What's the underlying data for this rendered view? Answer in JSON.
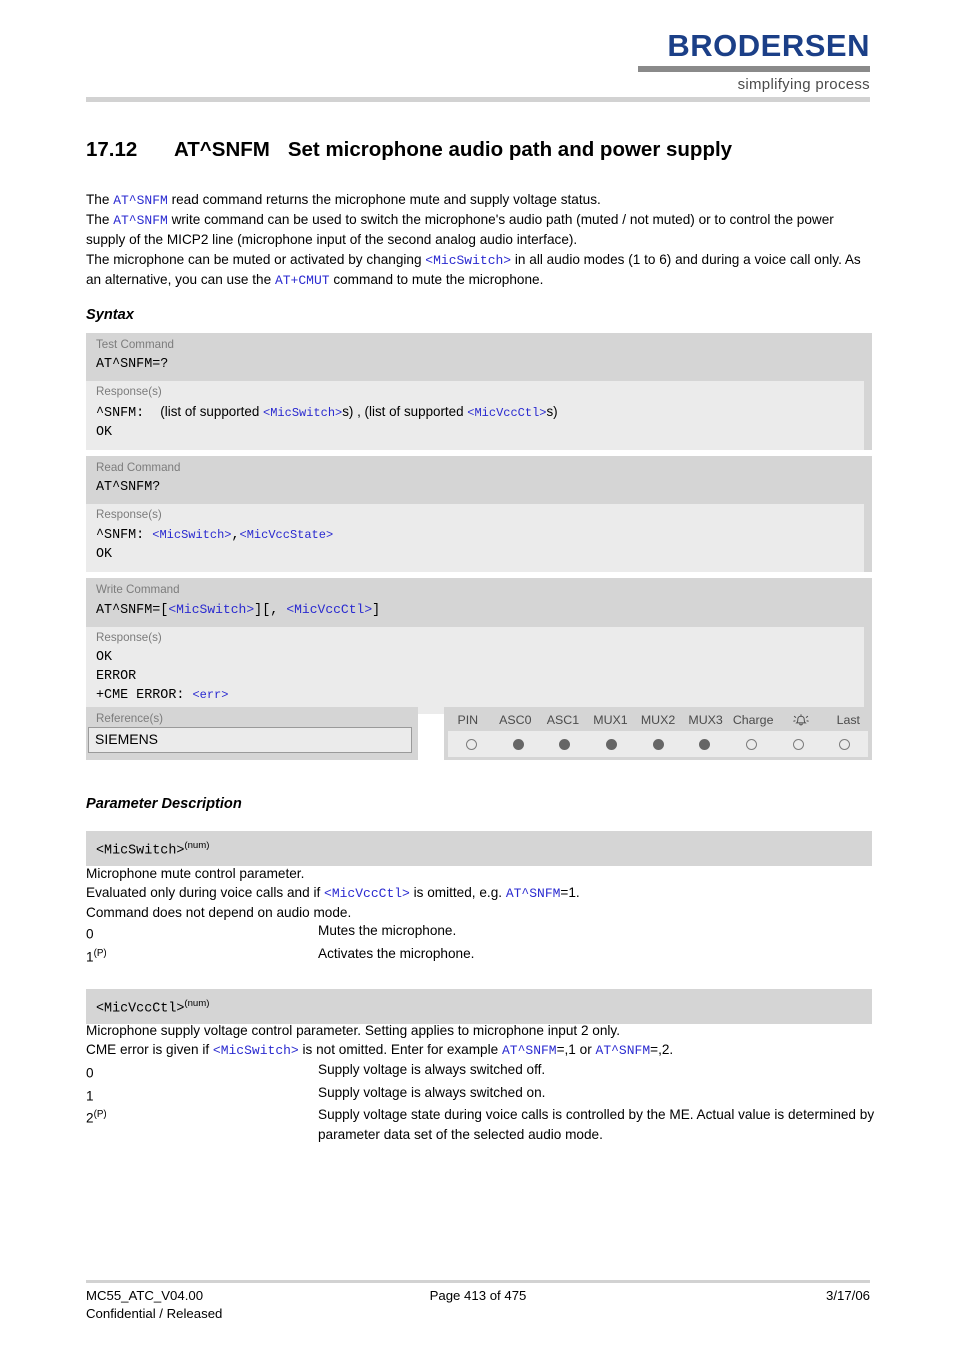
{
  "header": {
    "logo_word": "BRODERSEN",
    "logo_tagline": "simplifying process"
  },
  "title": {
    "number": "17.12",
    "command": "AT^SNFM",
    "text": "Set microphone audio path and power supply"
  },
  "intro": {
    "line1_a": "The ",
    "line1_cmd": "AT^SNFM",
    "line1_b": " read command returns the microphone mute and supply voltage status.",
    "line2_a": "The ",
    "line2_cmd": "AT^SNFM",
    "line2_b": " write command can be used to switch the microphone's audio path (muted / not muted) or to control the power supply of the MICP2 line (microphone input of the second analog audio interface).",
    "line3_a": "The microphone can be muted or activated by changing ",
    "line3_param": "<MicSwitch>",
    "line3_b": " in all audio modes (1 to 6) and during a voice call only. As an alternative, you can use the ",
    "line3_cmd": "AT+CMUT",
    "line3_c": " command to mute the microphone."
  },
  "sections": {
    "syntax": "Syntax",
    "parameter_description": "Parameter Description"
  },
  "syntax": {
    "test": {
      "label": "Test Command",
      "command": "AT^SNFM=?",
      "response_label": "Response(s)",
      "response_prefix": "^SNFM:",
      "response_text_a": "(list of supported ",
      "response_param1": "<MicSwitch>",
      "response_text_b": "s) , (list of supported ",
      "response_param2": "<MicVccCtl>",
      "response_text_c": "s)",
      "response_ok": "OK"
    },
    "read": {
      "label": "Read Command",
      "command": "AT^SNFM?",
      "response_label": "Response(s)",
      "response_prefix": "^SNFM:",
      "response_param1": "<MicSwitch>",
      "response_comma": ",",
      "response_param2": "<MicVccState>",
      "response_ok": "OK"
    },
    "write": {
      "label": "Write Command",
      "command_a": "AT^SNFM=[",
      "command_param1": "<MicSwitch>",
      "command_b": "][, ",
      "command_param2": "<MicVccCtl>",
      "command_c": "]",
      "response_label": "Response(s)",
      "response_ok": "OK",
      "response_error": "ERROR",
      "response_cme_a": "+CME ERROR: ",
      "response_cme_err": "<err>"
    }
  },
  "reference": {
    "label": "Reference(s)",
    "value": "SIEMENS"
  },
  "support_table": {
    "columns": [
      {
        "label": "PIN",
        "icon": null,
        "supported": false
      },
      {
        "label": "ASC0",
        "icon": null,
        "supported": true
      },
      {
        "label": "ASC1",
        "icon": null,
        "supported": true
      },
      {
        "label": "MUX1",
        "icon": null,
        "supported": true
      },
      {
        "label": "MUX2",
        "icon": null,
        "supported": true
      },
      {
        "label": "MUX3",
        "icon": null,
        "supported": true
      },
      {
        "label": "Charge",
        "icon": null,
        "supported": false
      },
      {
        "label": "",
        "icon": "alarm-bell-icon",
        "supported": false
      },
      {
        "label": "Last",
        "icon": null,
        "supported": false
      }
    ]
  },
  "parameters": [
    {
      "name": "<MicSwitch>",
      "type": "(num)",
      "description_line1": "Microphone mute control parameter.",
      "description_line2_a": "Evaluated only during voice calls and if ",
      "description_line2_param": "<MicVccCtl>",
      "description_line2_b": " is omitted, e.g. ",
      "description_line2_cmd": "AT^SNFM",
      "description_line2_c": "=1.",
      "description_line3": "Command does not depend on audio mode.",
      "options": [
        {
          "key": "0",
          "superscript": "",
          "value": "Mutes the microphone."
        },
        {
          "key": "1",
          "superscript": "(P)",
          "value": "Activates the microphone."
        }
      ]
    },
    {
      "name": "<MicVccCtl>",
      "type": "(num)",
      "description_line1": "Microphone supply voltage control parameter. Setting applies to microphone input 2 only.",
      "description_line2_a": "CME error is given if ",
      "description_line2_param": "<MicSwitch>",
      "description_line2_b": " is not omitted. Enter for example ",
      "description_line2_cmd": "AT^SNFM",
      "description_line2_c": "=,1 or ",
      "description_line2_cmd2": "AT^SNFM",
      "description_line2_d": "=,2.",
      "options": [
        {
          "key": "0",
          "superscript": "",
          "value": "Supply voltage is always switched off."
        },
        {
          "key": "1",
          "superscript": "",
          "value": "Supply voltage is always switched on."
        },
        {
          "key": "2",
          "superscript": "(P)",
          "value": "Supply voltage state during voice calls is controlled by the ME. Actual value is determined by parameter data set of the selected audio mode."
        }
      ]
    }
  ],
  "footer": {
    "document_id": "MC55_ATC_V04.00",
    "classification": "Confidential / Released",
    "page": "Page 413 of 475",
    "date": "3/17/06"
  },
  "colors": {
    "brand_blue": "#1b3f87",
    "link_blue": "#2a2ad0",
    "table_header_gray": "#d5d5d5",
    "table_response_gray": "#ebebeb",
    "rule_gray": "#d2d2d2"
  }
}
